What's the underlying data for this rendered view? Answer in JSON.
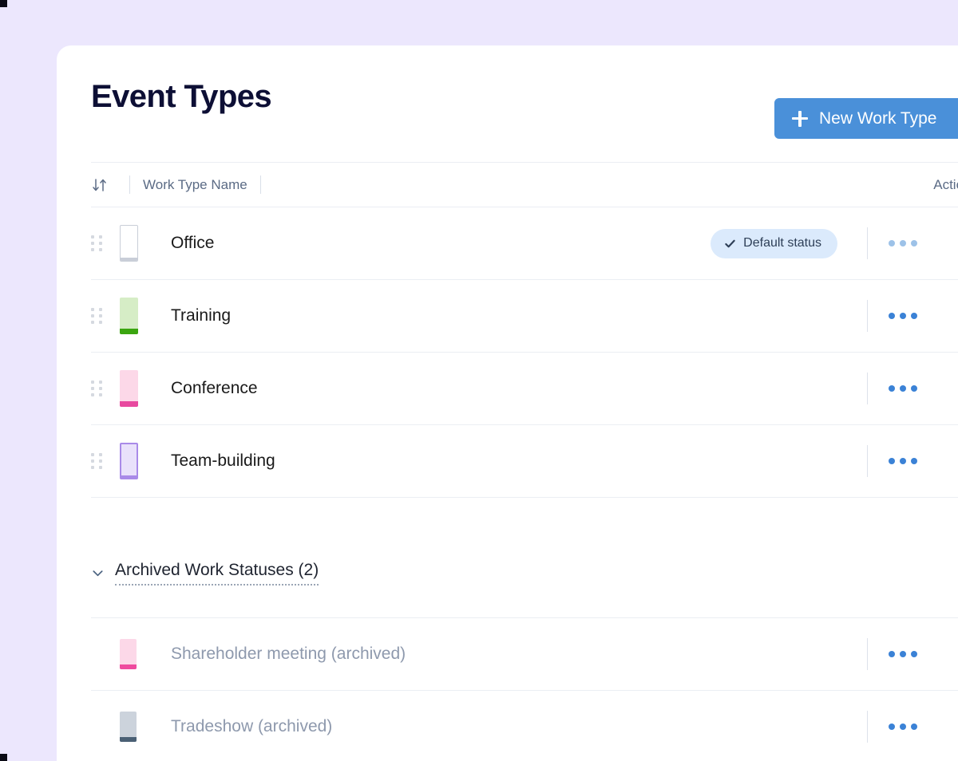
{
  "page": {
    "background_color": "#ece7fd",
    "card_background": "#ffffff"
  },
  "header": {
    "title": "Event Types",
    "new_type_button": {
      "label": "New Work Type",
      "icon": "plus-icon",
      "color": "#4a90d9"
    }
  },
  "table": {
    "columns": {
      "sort_icon": "↓↑",
      "name_header": "Work Type Name",
      "actions_header": "Actions"
    },
    "rows": [
      {
        "name": "Office",
        "swatch_fill": "#ffffff",
        "swatch_border": "#c9ced8",
        "swatch_bar": "#c9ced8",
        "badge": "Default status",
        "badge_color": "#dbeafc",
        "actions_icon": "more-horizontal-icon",
        "actions_muted": true
      },
      {
        "name": "Training",
        "swatch_fill": "#d6edc6",
        "swatch_border": "#d6edc6",
        "swatch_bar": "#3ba510",
        "badge": null,
        "actions_icon": "more-horizontal-icon",
        "actions_muted": false
      },
      {
        "name": "Conference",
        "swatch_fill": "#fcd8e8",
        "swatch_border": "#fcd8e8",
        "swatch_bar": "#e8499f",
        "badge": null,
        "actions_icon": "more-horizontal-icon",
        "actions_muted": false
      },
      {
        "name": "Team-building",
        "swatch_fill": "#e9e1fb",
        "swatch_border": "#a98ae8",
        "swatch_bar": "#a98ae8",
        "badge": null,
        "actions_icon": "more-horizontal-icon",
        "actions_muted": false
      }
    ]
  },
  "archived": {
    "toggle_icon": "chevron-down-icon",
    "title": "Archived Work Statuses (2)",
    "rows": [
      {
        "name": "Shareholder meeting (archived)",
        "swatch_fill": "#fcd8e8",
        "swatch_border": "#fcd8e8",
        "swatch_bar": "#ef4a9e",
        "actions_icon": "more-horizontal-icon"
      },
      {
        "name": "Tradeshow (archived)",
        "swatch_fill": "#ccd3dc",
        "swatch_border": "#ccd3dc",
        "swatch_bar": "#4a6075",
        "actions_icon": "more-horizontal-icon"
      }
    ]
  }
}
